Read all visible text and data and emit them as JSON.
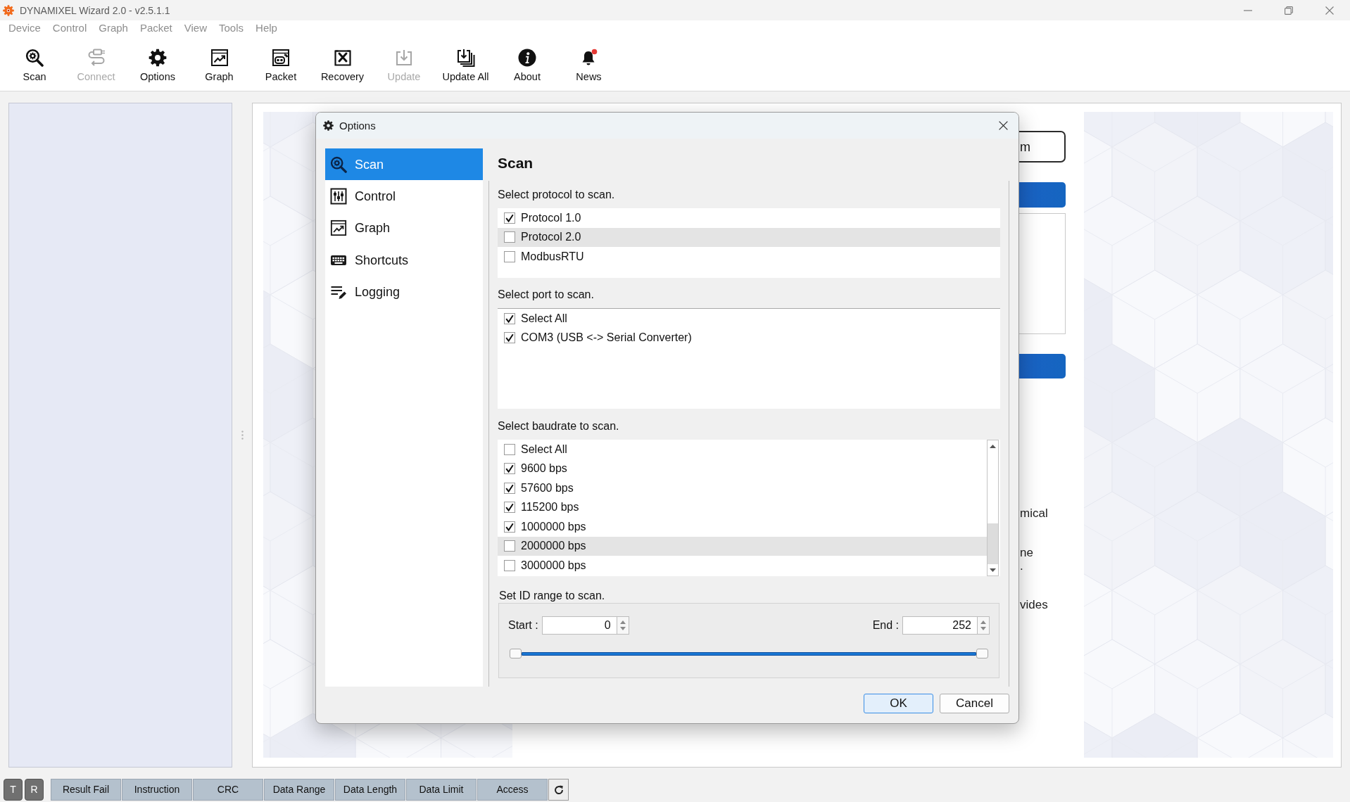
{
  "window": {
    "title": "DYNAMIXEL Wizard 2.0 - v2.5.1.1"
  },
  "menu": [
    "Device",
    "Control",
    "Graph",
    "Packet",
    "View",
    "Tools",
    "Help"
  ],
  "toolbar": [
    {
      "label": "Scan",
      "disabled": false
    },
    {
      "label": "Connect",
      "disabled": true
    },
    {
      "label": "Options",
      "disabled": false
    },
    {
      "label": "Graph",
      "disabled": false
    },
    {
      "label": "Packet",
      "disabled": false
    },
    {
      "label": "Recovery",
      "disabled": false
    },
    {
      "label": "Update",
      "disabled": true
    },
    {
      "label": "Update All",
      "disabled": false
    },
    {
      "label": "About",
      "disabled": false
    },
    {
      "label": "News",
      "disabled": false
    }
  ],
  "background_panel": {
    "button_label": "m",
    "texts": [
      "mical",
      "ne",
      ".",
      "vides"
    ]
  },
  "dialog": {
    "title": "Options",
    "nav": [
      {
        "label": "Scan",
        "selected": true
      },
      {
        "label": "Control",
        "selected": false
      },
      {
        "label": "Graph",
        "selected": false
      },
      {
        "label": "Shortcuts",
        "selected": false
      },
      {
        "label": "Logging",
        "selected": false
      }
    ],
    "heading": "Scan",
    "protocol_list": {
      "label": "Select protocol to scan.",
      "items": [
        {
          "label": "Protocol 1.0",
          "checked": true,
          "selected": false
        },
        {
          "label": "Protocol 2.0",
          "checked": false,
          "selected": true
        },
        {
          "label": "ModbusRTU",
          "checked": false,
          "selected": false
        }
      ]
    },
    "port_list": {
      "label": "Select port to scan.",
      "items": [
        {
          "label": "Select All",
          "checked": true,
          "selected": false
        },
        {
          "label": "COM3 (USB <-> Serial Converter)",
          "checked": true,
          "selected": false
        }
      ]
    },
    "baudrate_list": {
      "label": "Select baudrate to scan.",
      "items": [
        {
          "label": "Select All",
          "checked": false,
          "selected": false
        },
        {
          "label": "9600 bps",
          "checked": true,
          "selected": false
        },
        {
          "label": "57600 bps",
          "checked": true,
          "selected": false
        },
        {
          "label": "115200 bps",
          "checked": true,
          "selected": false
        },
        {
          "label": "1000000 bps",
          "checked": true,
          "selected": false
        },
        {
          "label": "2000000 bps",
          "checked": false,
          "selected": true
        },
        {
          "label": "3000000 bps",
          "checked": false,
          "selected": false
        }
      ]
    },
    "id_range": {
      "label": "Set ID range to scan.",
      "start_label": "Start :",
      "start": "0",
      "end_label": "End :",
      "end": "252",
      "slider": {
        "handles": [
          {
            "level": 0
          },
          {
            "level": 1
          }
        ]
      }
    },
    "buttons": [
      {
        "label": "OK",
        "default": true
      },
      {
        "label": "Cancel",
        "default": false
      }
    ]
  },
  "filter_bar": {
    "toggles": [
      "T",
      "R"
    ],
    "tabs": [
      "Result Fail",
      "Instruction",
      "CRC",
      "Data Range",
      "Data Length",
      "Data Limit",
      "Access"
    ]
  }
}
